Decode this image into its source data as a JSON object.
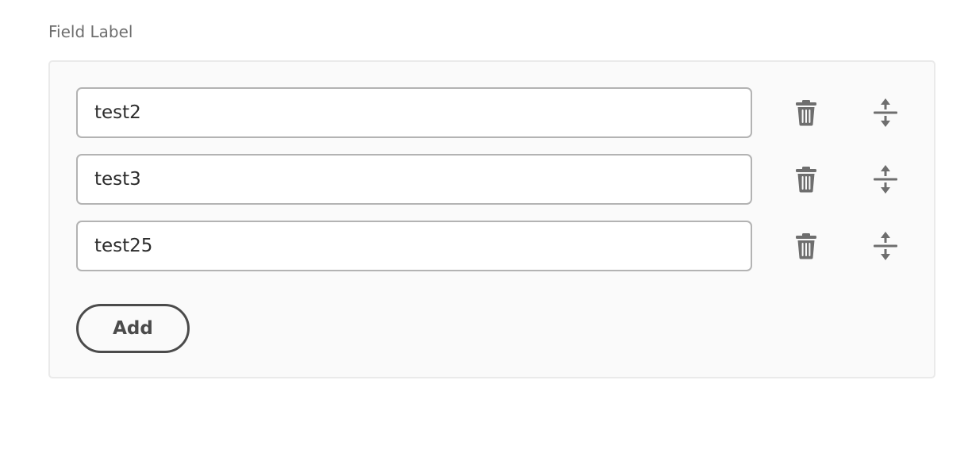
{
  "field": {
    "label": "Field Label"
  },
  "items": [
    {
      "value": "test2"
    },
    {
      "value": "test3"
    },
    {
      "value": "test25"
    }
  ],
  "icons": {
    "delete": "delete-icon",
    "move": "move-icon"
  },
  "add_button": {
    "label": "Add"
  },
  "colors": {
    "panel_background": "#fafafa",
    "panel_border": "#eaeaea",
    "input_border": "#b3b3b3",
    "icon": "#6e6e6e",
    "button_border": "#4b4b4b",
    "label_text": "#6e6e6e"
  }
}
